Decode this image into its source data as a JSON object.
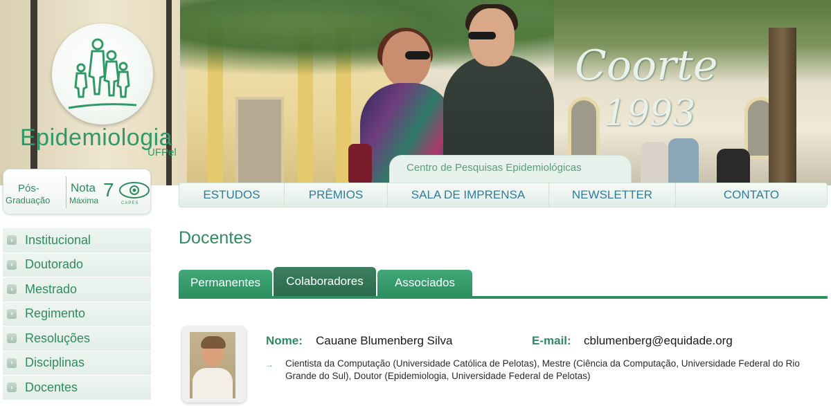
{
  "header": {
    "logo_title": "Epidemiologia",
    "logo_sub": "UFPel",
    "banner_title": "Coorte",
    "banner_year": "1993",
    "center_label": "Centro de Pesquisas Epidemiológicas"
  },
  "badge": {
    "pos_line1": "Pós-",
    "pos_line2": "Graduação",
    "nota_line1": "Nota",
    "nota_line2": "Máxima",
    "nota_value": "7",
    "capes_label": "CAPES"
  },
  "topnav": {
    "items": [
      {
        "label": "ESTUDOS"
      },
      {
        "label": "PRÊMIOS"
      },
      {
        "label": "SALA DE IMPRENSA"
      },
      {
        "label": "NEWSLETTER"
      },
      {
        "label": "CONTATO"
      }
    ]
  },
  "sidebar": {
    "items": [
      {
        "label": "Institucional"
      },
      {
        "label": "Doutorado"
      },
      {
        "label": "Mestrado"
      },
      {
        "label": "Regimento"
      },
      {
        "label": "Resoluções"
      },
      {
        "label": "Disciplinas"
      },
      {
        "label": "Docentes"
      }
    ]
  },
  "main": {
    "title": "Docentes",
    "tabs": [
      {
        "label": "Permanentes",
        "active": false
      },
      {
        "label": "Colaboradores",
        "active": true
      },
      {
        "label": "Associados",
        "active": false
      }
    ],
    "person": {
      "name_label": "Nome:",
      "name": "Cauane Blumenberg Silva",
      "email_label": "E-mail:",
      "email": "cblumenberg@equidade.org",
      "bio_arrow": "→",
      "bio": "Cientista da Computação (Universidade Católica de Pelotas), Mestre (Ciência da Computação, Universidade Federal do Rio Grande do Sul), Doutor (Epidemiologia, Universidade Federal de Pelotas)"
    }
  },
  "colors": {
    "brand_green": "#2f8a60",
    "nav_blue": "#2f7c9a",
    "tab_green": "#2e8f60",
    "tab_active": "#2c6b4c"
  }
}
